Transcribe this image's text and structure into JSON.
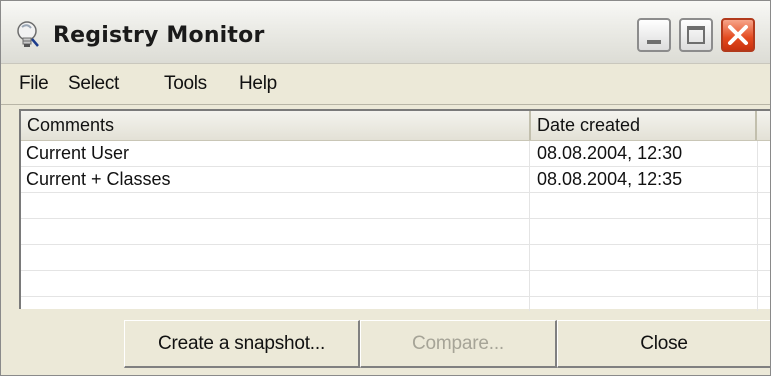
{
  "window": {
    "title": "Registry Monitor",
    "icon": "registry-monitor-app-icon",
    "controls": {
      "minimize_icon": "minimize-icon",
      "maximize_icon": "maximize-icon",
      "close_icon": "close-icon"
    }
  },
  "menu": {
    "items": [
      "File",
      "Select",
      "Tools",
      "Help"
    ]
  },
  "list": {
    "columns": [
      "Comments",
      "Date created"
    ],
    "rows": [
      {
        "comment": "Current User",
        "date": "08.08.2004, 12:30"
      },
      {
        "comment": "Current + Classes",
        "date": "08.08.2004, 12:35"
      }
    ]
  },
  "buttons": {
    "snapshot": "Create a snapshot...",
    "compare": "Compare...",
    "close": "Close",
    "compare_enabled": false
  },
  "colors": {
    "window_bg": "#ece9d8",
    "close_button": "#e34a1f",
    "disabled_text": "#a6a497"
  }
}
